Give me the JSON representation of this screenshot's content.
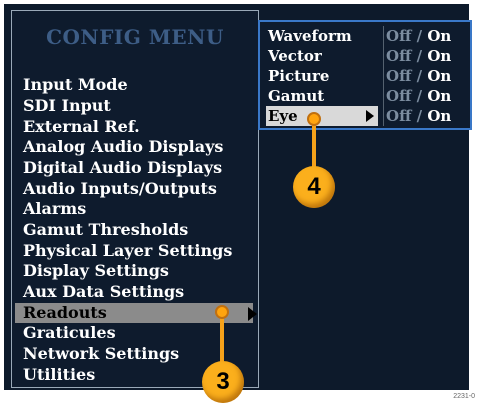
{
  "main_menu": {
    "title": "CONFIG MENU",
    "items": [
      {
        "label": "Input Mode"
      },
      {
        "label": "SDI Input"
      },
      {
        "label": "External Ref."
      },
      {
        "label": "Analog Audio Displays"
      },
      {
        "label": "Digital Audio Displays"
      },
      {
        "label": "Audio Inputs/Outputs"
      },
      {
        "label": "Alarms"
      },
      {
        "label": "Gamut Thresholds"
      },
      {
        "label": "Physical Layer Settings"
      },
      {
        "label": "Display Settings"
      },
      {
        "label": "Aux Data Settings"
      },
      {
        "label": "Readouts",
        "selected": true
      },
      {
        "label": "Graticules"
      },
      {
        "label": "Network Settings"
      },
      {
        "label": "Utilities"
      }
    ]
  },
  "readouts_submenu": {
    "rows": [
      {
        "label": "Waveform",
        "off": "Off",
        "sep": "/",
        "on": "On"
      },
      {
        "label": "Vector",
        "off": "Off",
        "sep": "/",
        "on": "On"
      },
      {
        "label": "Picture",
        "off": "Off",
        "sep": "/",
        "on": "On"
      },
      {
        "label": "Gamut",
        "off": "Off",
        "sep": "/",
        "on": "On"
      },
      {
        "label": "Eye",
        "off": "Off",
        "sep": "/",
        "on": "On",
        "selected": true
      }
    ]
  },
  "callouts": {
    "step_3": "3",
    "step_4": "4"
  },
  "figure_id": "2231-0",
  "colors": {
    "screen_bg": "#0d1a2b",
    "highlight": "#8b8b8b",
    "submenu_border": "#3a78c8",
    "callout": "#fbaf1c"
  }
}
